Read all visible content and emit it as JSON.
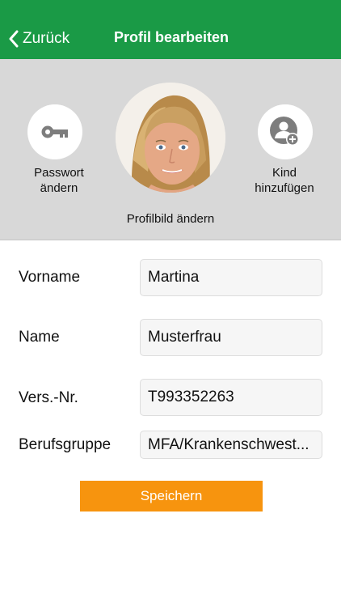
{
  "navbar": {
    "back_label": "Zurück",
    "title": "Profil bearbeiten",
    "background": "#1a9a46"
  },
  "profile": {
    "password_button": {
      "icon": "key-icon",
      "label_line1": "Passwort",
      "label_line2": "ändern"
    },
    "avatar_label": "Profilbild ändern",
    "add_child_button": {
      "icon": "add-person-icon",
      "label_line1": "Kind",
      "label_line2": "hinzufügen"
    },
    "panel_background": "#d8d8d8"
  },
  "form": {
    "first_name": {
      "label": "Vorname",
      "value": "Martina"
    },
    "last_name": {
      "label": "Name",
      "value": "Musterfrau"
    },
    "insurance_number": {
      "label": "Vers.-Nr.",
      "value": "T993352263"
    },
    "profession": {
      "label": "Berufsgruppe",
      "value": "MFA/Krankenschwest..."
    }
  },
  "save_button": {
    "label": "Speichern",
    "background": "#f7940e"
  }
}
